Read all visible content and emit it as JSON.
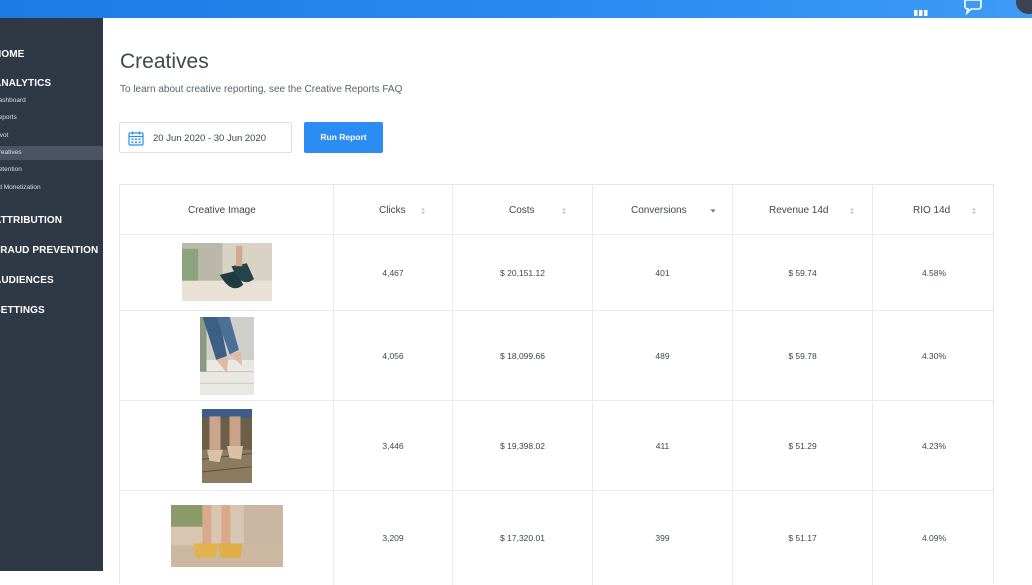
{
  "page": {
    "title": "Creatives",
    "subtitle": "To learn about creative reporting, see the Creative Reports FAQ"
  },
  "sidebar": {
    "items": [
      {
        "label": "HOME",
        "kind": "main"
      },
      {
        "label": "ANALYTICS",
        "kind": "main"
      },
      {
        "label": "Dashboard",
        "kind": "sub"
      },
      {
        "label": "Reports",
        "kind": "sub"
      },
      {
        "label": "Pivot",
        "kind": "sub"
      },
      {
        "label": "Creatives",
        "kind": "sub",
        "active": true
      },
      {
        "label": "Retention",
        "kind": "sub"
      },
      {
        "label": "Ad Monetization",
        "kind": "sub"
      },
      {
        "label": "ATTRIBUTION",
        "kind": "main"
      },
      {
        "label": "FRAUD PREVENTION",
        "kind": "main"
      },
      {
        "label": "AUDIENCES",
        "kind": "main"
      },
      {
        "label": "SETTINGS",
        "kind": "main"
      }
    ]
  },
  "controls": {
    "date_range": "20 Jun 2020 - 30 Jun 2020",
    "run_label": "Run Report"
  },
  "table": {
    "headers": [
      "Creative Image",
      "Clicks",
      "Costs",
      "Conversions",
      "Revenue 14d",
      "RIO 14d"
    ],
    "rows": [
      {
        "clicks": "4,467",
        "costs": "$ 20,151.12",
        "conversions": "401",
        "revenue": "$ 59.74",
        "rio": "4.58%"
      },
      {
        "clicks": "4,056",
        "costs": "$ 18,099.66",
        "conversions": "489",
        "revenue": "$ 59.78",
        "rio": "4.30%"
      },
      {
        "clicks": "3,446",
        "costs": "$ 19,398.02",
        "conversions": "411",
        "revenue": "$ 51.29",
        "rio": "4.23%"
      },
      {
        "clicks": "3,209",
        "costs": "$ 17,320.01",
        "conversions": "399",
        "revenue": "$ 51.17",
        "rio": "4.09%"
      }
    ]
  },
  "colors": {
    "accent": "#2b8cf2",
    "sidebar_bg": "#2f3946",
    "topbar": "#2a8cf0"
  },
  "icons": {
    "topbar": [
      "grid-icon",
      "chat-icon",
      "avatar"
    ],
    "date": "calendar-icon",
    "sort": "sort-icon"
  }
}
